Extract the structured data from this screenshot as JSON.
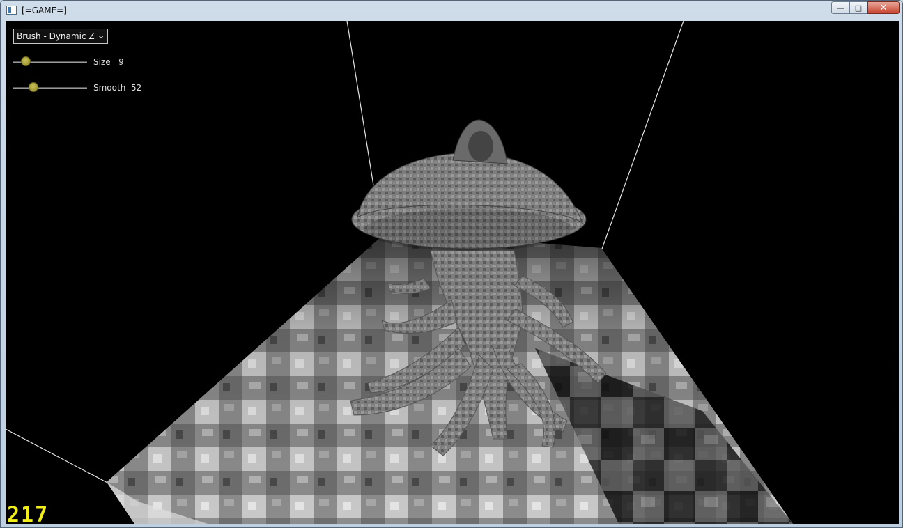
{
  "window": {
    "title": "[=GAME=]",
    "controls": {
      "minimize": "—",
      "maximize": "□",
      "close": "✕"
    }
  },
  "hud": {
    "brush_mode": "Brush - Dynamic Z",
    "size": {
      "label": "Size",
      "value": "9",
      "fraction": 0.12
    },
    "smooth": {
      "label": "Smooth",
      "value": "52",
      "fraction": 0.24
    },
    "fps": "217"
  },
  "colors": {
    "fps": "#f2ee1a",
    "slider_thumb": "#b3ab3a",
    "background": "#000000"
  }
}
